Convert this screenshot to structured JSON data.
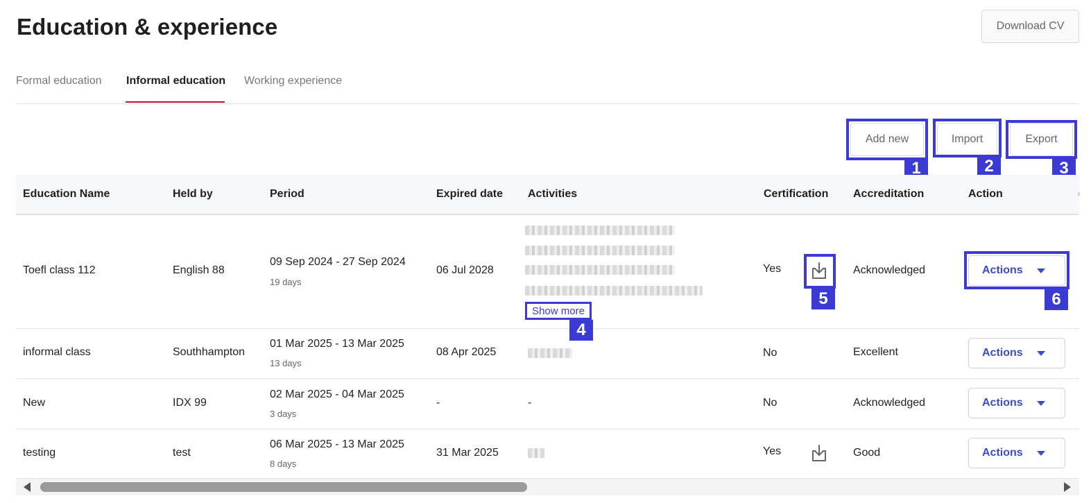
{
  "page": {
    "title": "Education & experience",
    "download_label": "Download CV"
  },
  "tabs": [
    {
      "label": "Formal education",
      "active": false
    },
    {
      "label": "Informal education",
      "active": true
    },
    {
      "label": "Working experience",
      "active": false
    }
  ],
  "toolbar": {
    "add_label": "Add new",
    "import_label": "Import",
    "export_label": "Export"
  },
  "annotations": [
    "1",
    "2",
    "3",
    "4",
    "5",
    "6"
  ],
  "table": {
    "columns": [
      "Education Name",
      "Held by",
      "Period",
      "Expired date",
      "Activities",
      "Certification",
      "Accreditation",
      "Action"
    ],
    "rows": [
      {
        "name": "Toefl class 112",
        "held_by": "English 88",
        "period": "09 Sep 2024 - 27 Sep 2024",
        "duration": "19 days",
        "expired": "06 Jul 2028",
        "activities": "",
        "show_more": "Show more",
        "certification": "Yes",
        "accreditation": "Acknowledged",
        "action": "Actions"
      },
      {
        "name": "informal class",
        "held_by": "Southhampton",
        "period": "01 Mar 2025 - 13 Mar 2025",
        "duration": "13 days",
        "expired": "08 Apr 2025",
        "activities": "",
        "certification": "No",
        "accreditation": "Excellent",
        "action": "Actions"
      },
      {
        "name": "New",
        "held_by": "IDX 99",
        "period": "02 Mar 2025 - 04 Mar 2025",
        "duration": "3 days",
        "expired": "-",
        "activities": "-",
        "certification": "No",
        "accreditation": "Acknowledged",
        "action": "Actions"
      },
      {
        "name": "testing",
        "held_by": "test",
        "period": "06 Mar 2025 - 13 Mar 2025",
        "duration": "8 days",
        "expired": "31 Mar 2025",
        "activities": "",
        "certification": "Yes",
        "accreditation": "Good",
        "action": "Actions"
      }
    ]
  },
  "icons": {
    "certificate_download": "download-icon",
    "dropdown": "caret-down-icon"
  },
  "colors": {
    "accent": "#c8102e",
    "highlight": "#3b3bd4",
    "action_text": "#3b4cc0"
  }
}
